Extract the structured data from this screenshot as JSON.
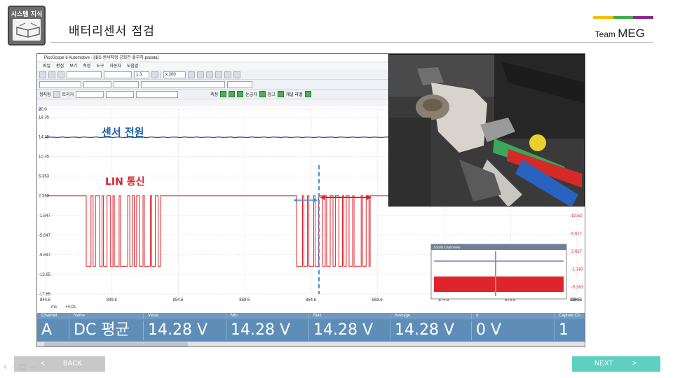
{
  "header": {
    "logo_label": "시스템 지식",
    "title": "배터리센서 점검",
    "brand_small": "Team",
    "brand_big": "MEG",
    "brand_stripe_colors": [
      "#f2c200",
      "#3fae49",
      "#8a2a8a"
    ]
  },
  "app": {
    "window_title": "PicoScope 6 Automotive - [IBS 센서파형 공회전 풀부하.psdata]",
    "menu": [
      "파일",
      "편집",
      "보기",
      "측정",
      "도구",
      "자동차",
      "도움말"
    ],
    "toolbar1": {
      "buffer_value": "1 3",
      "zoom_value": "x 200"
    },
    "toolbar3": {
      "stop_label": "정지됨",
      "trigger_label": "트리거",
      "measure_label": "측정",
      "ruler_label": "눈금자",
      "ref_label": "참고",
      "channel_label": "채널 라벨"
    },
    "plot": {
      "y_unit": "V",
      "y_ticks": [
        "20.0",
        "18.35",
        "14.35",
        "10.35",
        "6.353",
        "2.353",
        "-1.647",
        "-5.647",
        "-9.647",
        "-13.65",
        "-17.65"
      ],
      "x_ticks": [
        "844.6",
        "849.6",
        "854.6",
        "859.6",
        "864.6",
        "869.6",
        "874.6",
        "879.6",
        "884.6",
        "894.6"
      ],
      "x_unit": "ms",
      "x_offset": "+4.0s",
      "right_ticks": [
        "10.62",
        "6.617",
        "2.617",
        "-1.383",
        "-5.383"
      ],
      "annotation_power": "센서 전원",
      "annotation_lin": "LIN 통신",
      "zoom_overview_title": "Zoom Overview",
      "colors": {
        "channel_a": "#2e3fa6",
        "channel_b": "#e0242c",
        "annotation_power": "#1d5fa8",
        "annotation_lin": "#d8232a",
        "marker_blue": "#4a90d9",
        "marker_red": "#d8232a"
      }
    },
    "chart_data": {
      "type": "line",
      "x_unit": "ms",
      "xlim": [
        844.6,
        884.6
      ],
      "y_unit": "V",
      "ylim": [
        -17.65,
        20.0
      ],
      "series": [
        {
          "name": "A",
          "values": [
            14.28
          ]
        },
        {
          "name": "B",
          "values": [
            2.353,
            -12.0
          ]
        }
      ]
    },
    "readout": {
      "headers": [
        "Channel",
        "Name",
        "Value",
        "Min",
        "Max",
        "Average",
        "σ",
        "Capture Co..."
      ],
      "row": [
        "A",
        "DC 평균",
        "14.28 V",
        "14.28 V",
        "14.28 V",
        "14.28 V",
        "0 V",
        "1"
      ]
    }
  },
  "nav": {
    "back_arrow": "<",
    "back_label": "BACK",
    "next_label": "NEXT",
    "next_arrow": ">"
  }
}
